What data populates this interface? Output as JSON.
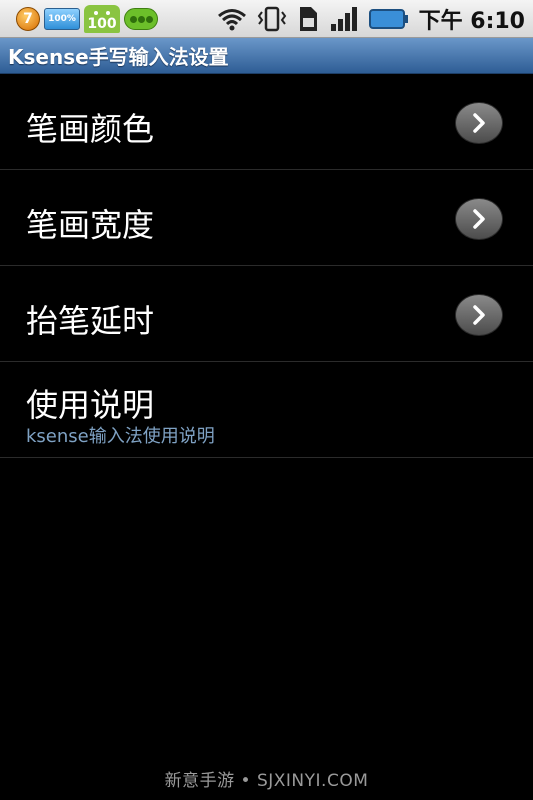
{
  "status_bar": {
    "badge_count": "7",
    "battery_notice": "100%",
    "android_badge": "100",
    "time": "下午 6:10"
  },
  "title_bar": {
    "title": "Ksense手写输入法设置"
  },
  "settings": {
    "items": [
      {
        "label": "笔画颜色"
      },
      {
        "label": "笔画宽度"
      },
      {
        "label": "抬笔延时"
      },
      {
        "label": "使用说明",
        "sublabel": "ksense输入法使用说明"
      }
    ]
  },
  "watermark": "新意手游 • SJXINYI.COM",
  "colors": {
    "title_bar": "#2e5d95",
    "background": "#000000",
    "sublabel": "#7fa2c4"
  }
}
